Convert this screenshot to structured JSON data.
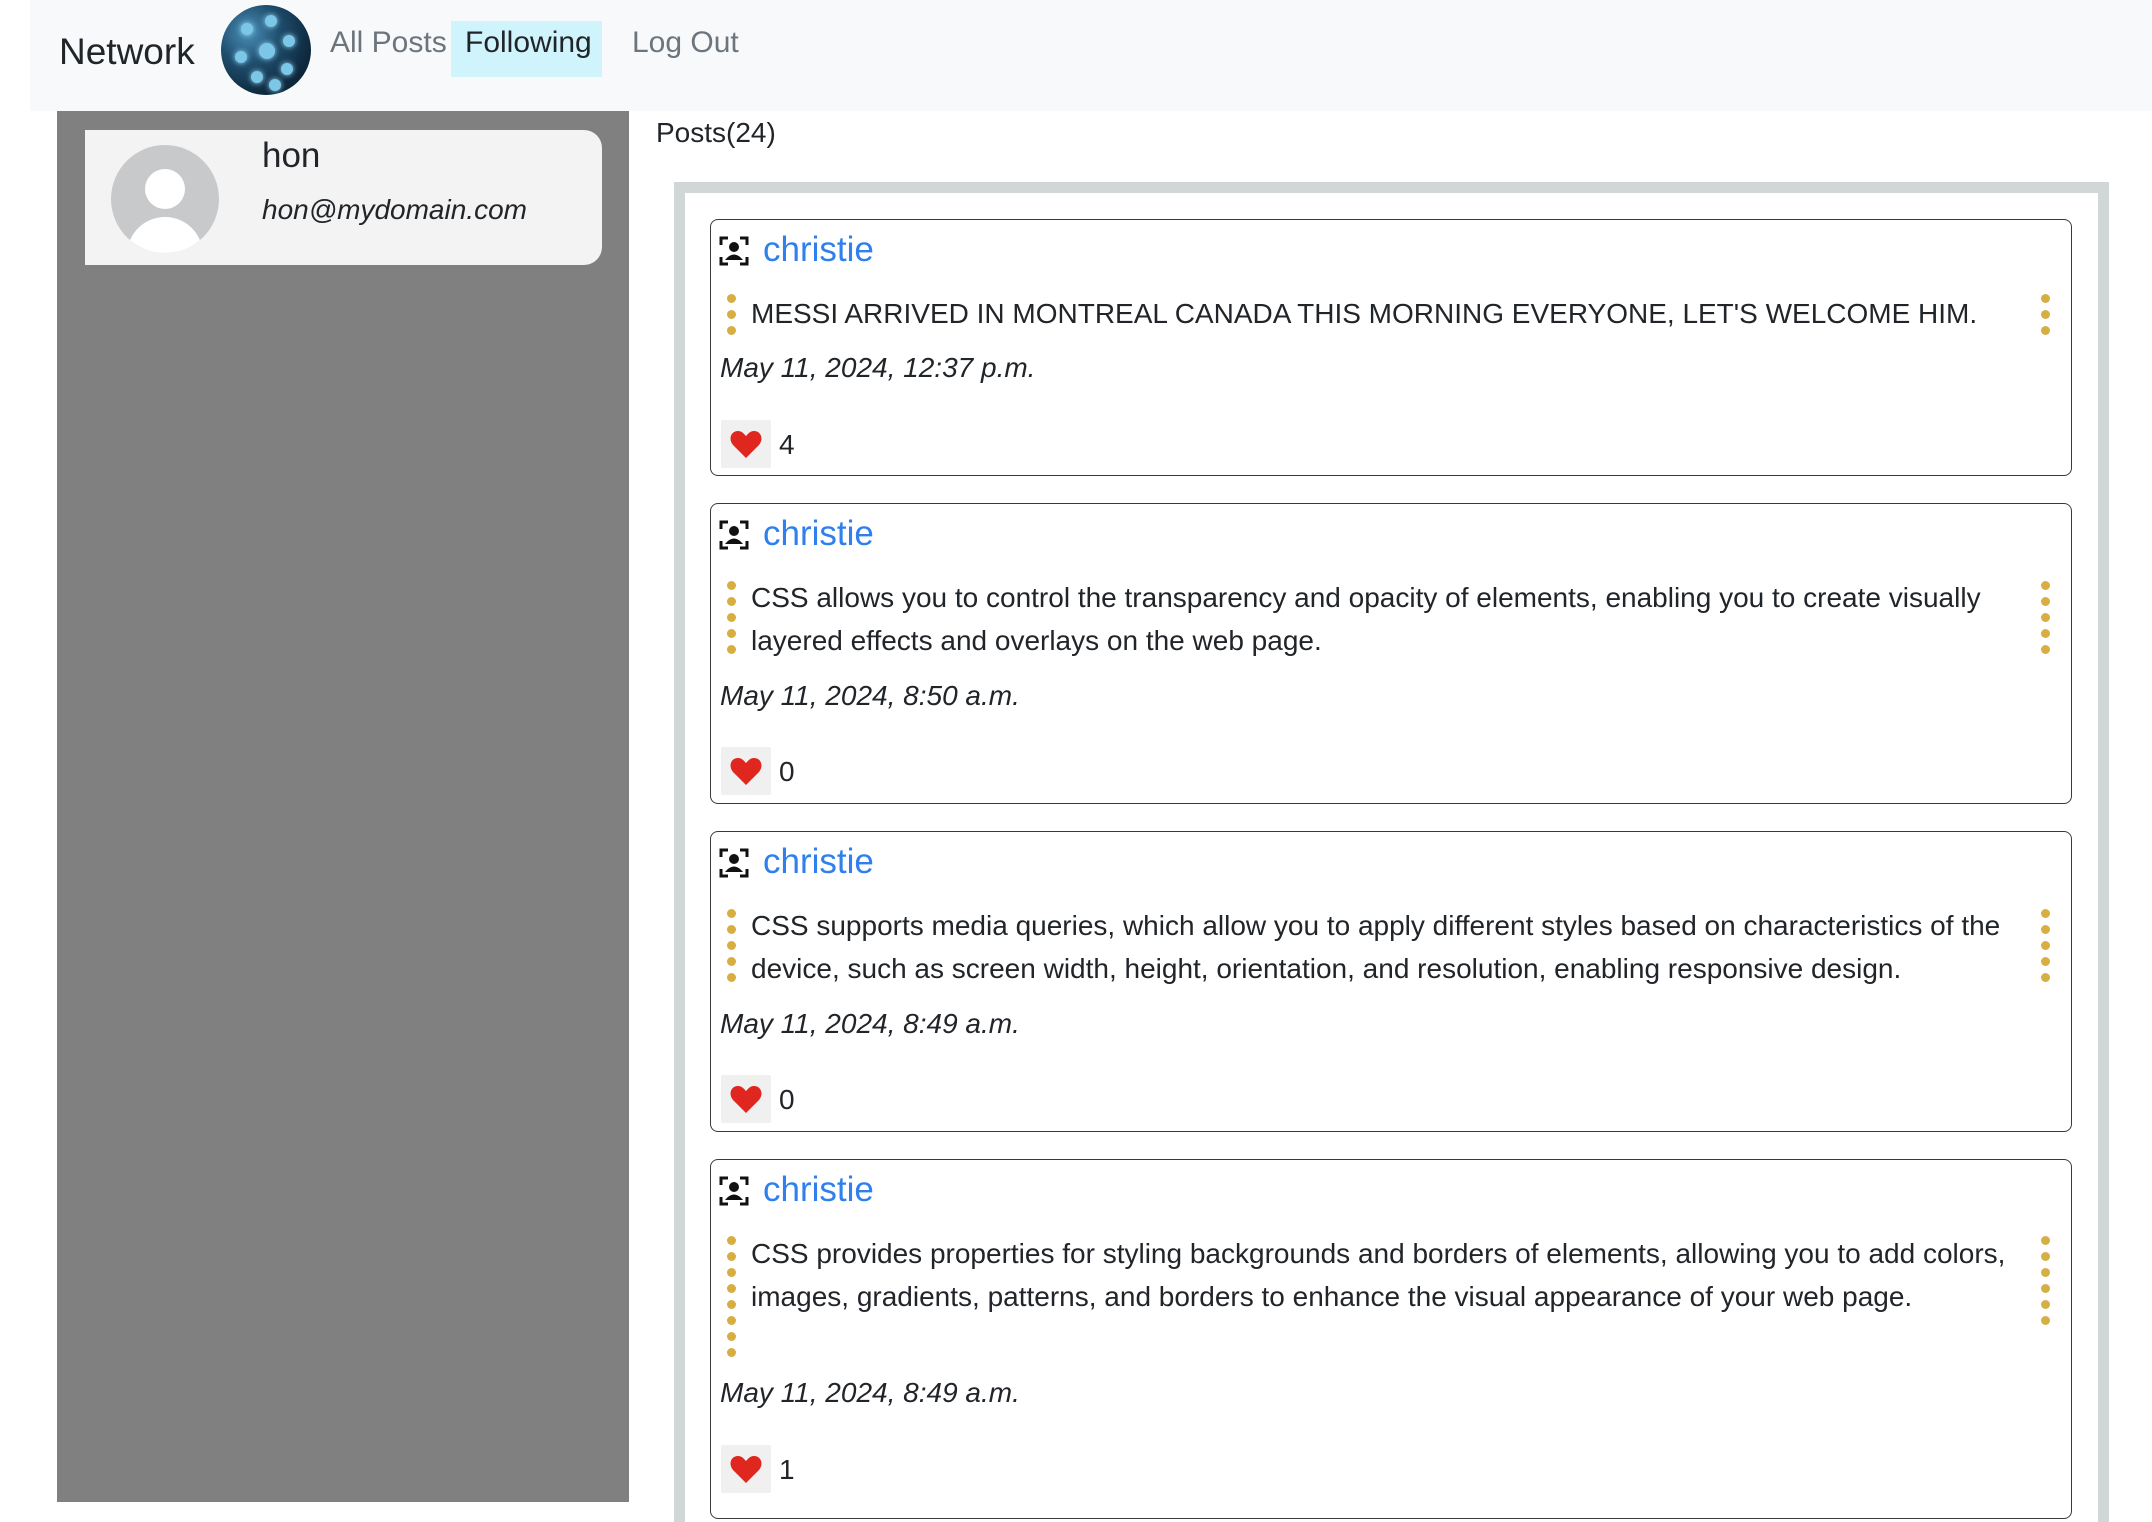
{
  "navbar": {
    "brand": "Network",
    "logo_icon": "network-globe-icon",
    "links": [
      {
        "label": "All Posts",
        "active": false
      },
      {
        "label": "Following",
        "active": true
      },
      {
        "label": "Log Out",
        "active": false
      }
    ]
  },
  "profile": {
    "username": "hon",
    "email": "hon@mydomain.com",
    "avatar_icon": "default-user-avatar-icon"
  },
  "posts_header": "Posts(24)",
  "posts": [
    {
      "author": "christie",
      "content": "MESSI ARRIVED IN MONTREAL CANADA THIS MORNING EVERYONE, LET'S WELCOME HIM.",
      "date": "May 11, 2024, 12:37 p.m.",
      "likes": "4"
    },
    {
      "author": "christie",
      "content": "CSS allows you to control the transparency and opacity of elements, enabling you to create visually layered effects and overlays on the web page.",
      "date": "May 11, 2024, 8:50 a.m.",
      "likes": "0"
    },
    {
      "author": "christie",
      "content": "CSS supports media queries, which allow you to apply different styles based on characteristics of the device, such as screen width, height, orientation, and resolution, enabling responsive design.",
      "date": "May 11, 2024, 8:49 a.m.",
      "likes": "0"
    },
    {
      "author": "christie",
      "content": "CSS provides properties for styling backgrounds and borders of elements, allowing you to add colors, images, gradients, patterns, and borders to enhance the visual appearance of your web page.",
      "date": "May 11, 2024, 8:49 a.m.",
      "likes": "1"
    }
  ],
  "colors": {
    "link": "#2f80ed",
    "dots": "#d6ae42",
    "heart": "#e0271f",
    "sidebar": "#808080",
    "active_nav": "#cff4fc"
  }
}
